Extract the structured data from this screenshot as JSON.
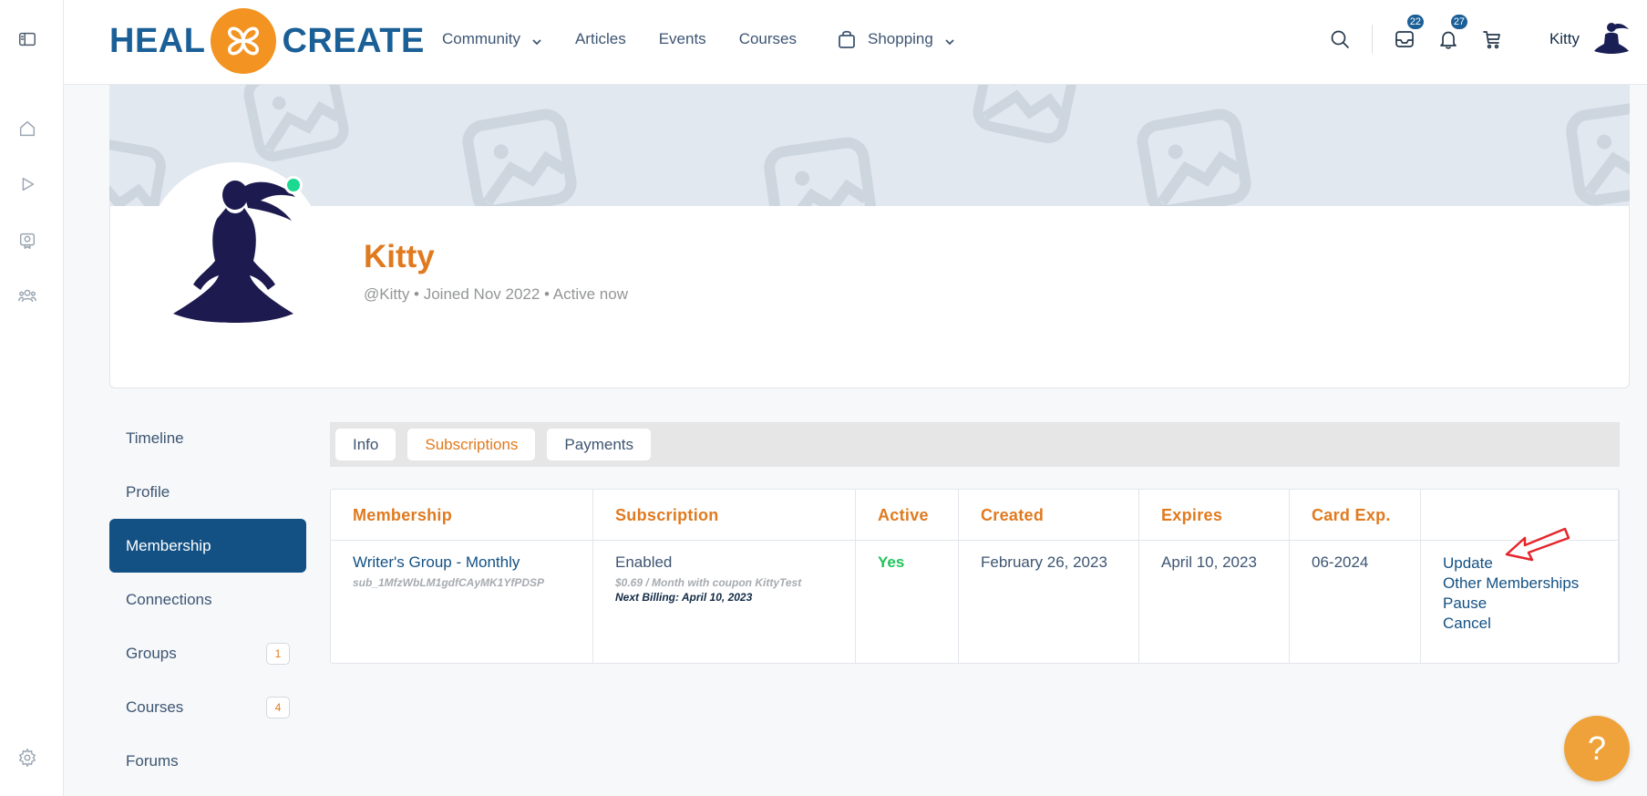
{
  "brand": {
    "left": "HEAL",
    "right": "CREATE",
    "accent": "#f39322",
    "primary": "#1b5f97"
  },
  "nav": {
    "community": "Community",
    "articles": "Articles",
    "events": "Events",
    "courses": "Courses",
    "shopping": "Shopping"
  },
  "header": {
    "messages_count": "22",
    "notifications_count": "27",
    "user_name": "Kitty"
  },
  "rail": {
    "icons": [
      "sidebar-toggle-icon",
      "home-icon",
      "play-icon",
      "badge-icon",
      "members-icon",
      "settings-icon"
    ]
  },
  "profile": {
    "name": "Kitty",
    "meta": "@Kitty • Joined Nov 2022 • Active now",
    "online_color": "#1cd991"
  },
  "profile_nav": {
    "timeline": "Timeline",
    "profile": "Profile",
    "membership": "Membership",
    "connections": "Connections",
    "groups": "Groups",
    "groups_count": "1",
    "courses": "Courses",
    "courses_count": "4",
    "forums": "Forums"
  },
  "tabs": {
    "info": "Info",
    "subscriptions": "Subscriptions",
    "payments": "Payments"
  },
  "table": {
    "headers": {
      "membership": "Membership",
      "subscription": "Subscription",
      "active": "Active",
      "created": "Created",
      "expires": "Expires",
      "card_exp": "Card Exp."
    },
    "row": {
      "membership_name": "Writer's Group - Monthly",
      "subscription_id": "sub_1MfzWbLM1gdfCAyMK1YfPDSP",
      "status": "Enabled",
      "price_note": "$0.69 / Month with coupon KittyTest",
      "next_billing": "Next Billing: April 10, 2023",
      "active": "Yes",
      "created": "February 26, 2023",
      "expires": "April 10, 2023",
      "card_exp": "06-2024",
      "actions": {
        "update": "Update",
        "other": "Other Memberships",
        "pause": "Pause",
        "cancel": "Cancel"
      }
    }
  },
  "help_button": "?"
}
